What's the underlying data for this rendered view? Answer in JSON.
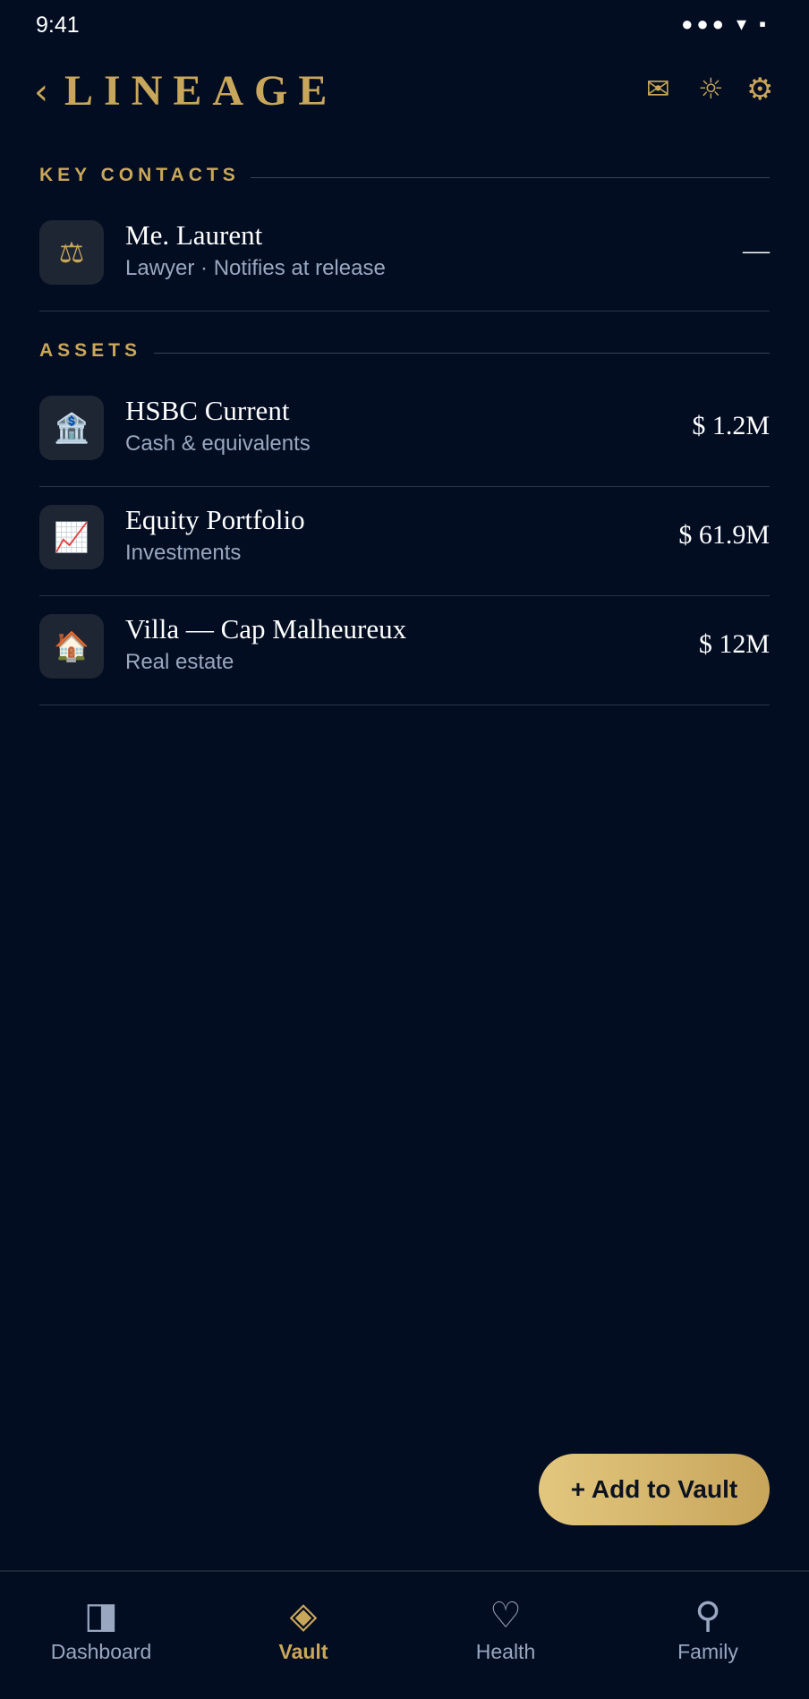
{
  "status_bar": {
    "time": "9:41",
    "icons": "●●● ▾ ▪"
  },
  "header": {
    "back_icon": "‹",
    "brand": "LINEAGE",
    "mail_icon": "✉",
    "sun_icon": "☼",
    "gear_icon": "⚙"
  },
  "key_contacts": {
    "title": "KEY CONTACTS",
    "items": [
      {
        "icon": "⚖",
        "name": "Me. Laurent",
        "subtitle": "Lawyer · Notifies at release",
        "value": "—"
      }
    ]
  },
  "assets": {
    "title": "ASSETS",
    "items": [
      {
        "icon": "🏦",
        "name": "HSBC Current",
        "subtitle": "Cash & equivalents",
        "value": "$ 1.2M"
      },
      {
        "icon": "📈",
        "name": "Equity Portfolio",
        "subtitle": "Investments",
        "value": "$ 61.9M"
      },
      {
        "icon": "🏠",
        "name": "Villa — Cap Malheureux",
        "subtitle": "Real estate",
        "value": "$ 12M"
      }
    ]
  },
  "fab": {
    "label": "+ Add to Vault"
  },
  "tabbar": {
    "active": "Vault",
    "tabs": [
      {
        "icon": "◨",
        "label": "Dashboard"
      },
      {
        "icon": "◈",
        "label": "Vault"
      },
      {
        "icon": "♡",
        "label": "Health"
      },
      {
        "icon": "⚲",
        "label": "Family"
      }
    ]
  },
  "colors": {
    "background": "#020d22",
    "accent": "#c9a75a",
    "muted": "#9aa7c0",
    "tile": "#1e2533"
  }
}
